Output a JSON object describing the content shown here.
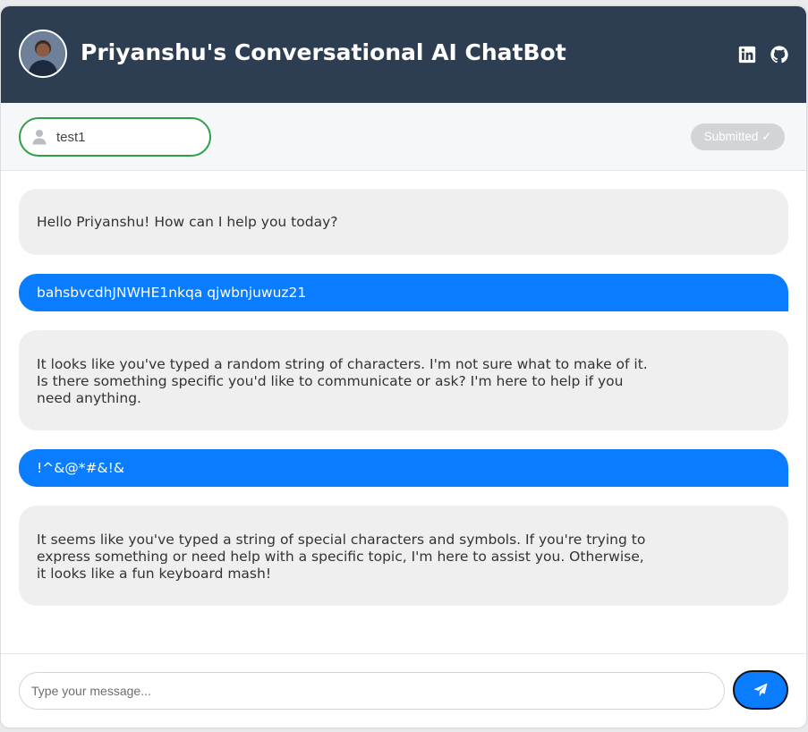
{
  "header": {
    "title": "Priyanshu's Conversational AI ChatBot",
    "avatar_icon": "user-photo",
    "links": [
      {
        "name": "linkedin-icon"
      },
      {
        "name": "github-icon"
      }
    ]
  },
  "userbar": {
    "username_value": "test1",
    "submit_label": "Submitted ✓"
  },
  "messages": [
    {
      "role": "bot",
      "text": "Hello Priyanshu! How can I help you today?"
    },
    {
      "role": "user",
      "text": "bahsbvcdhJNWHE1nkqa qjwbnjuwuz21"
    },
    {
      "role": "bot",
      "text": "It looks like you've typed a random string of characters. I'm not sure what to make of it. Is there something specific you'd like to communicate or ask? I'm here to help if you need anything."
    },
    {
      "role": "user",
      "text": "!^&@*#&!&"
    },
    {
      "role": "bot",
      "text": "It seems like you've typed a string of special characters and symbols. If you're trying to express something or need help with a specific topic, I'm here to assist you. Otherwise, it looks like a fun keyboard mash!"
    }
  ],
  "composer": {
    "placeholder": "Type your message...",
    "send_icon": "paper-plane-icon"
  },
  "colors": {
    "header_bg": "#2e3e52",
    "user_bubble": "#0a7cff",
    "bot_bubble": "#efefef",
    "input_border_active": "#2ea043"
  }
}
